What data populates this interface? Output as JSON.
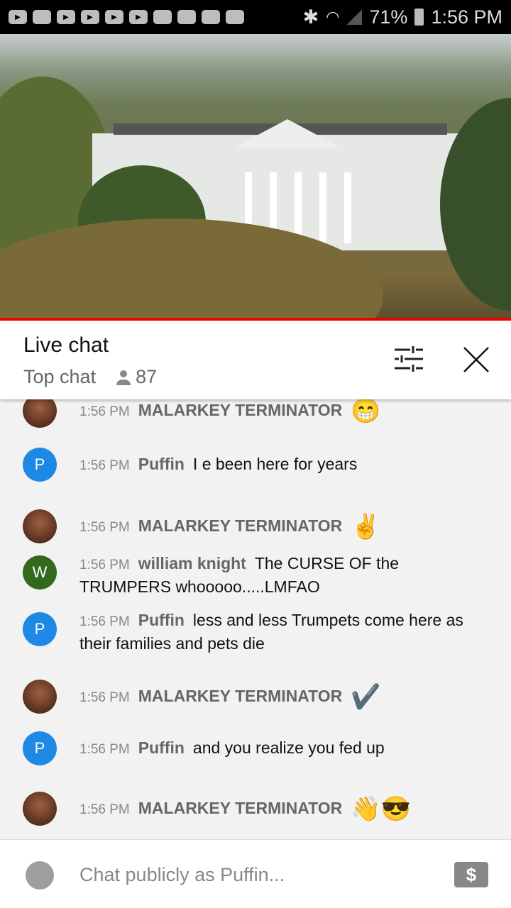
{
  "status_bar": {
    "battery": "71%",
    "time": "1:56 PM",
    "icons": [
      "youtube-icon",
      "crown-icon",
      "youtube-icon",
      "youtube-icon",
      "youtube-icon",
      "youtube-icon",
      "folder-icon",
      "warning-icon",
      "image-icon",
      "shopping-bag-icon",
      "bluetooth-icon",
      "wifi-icon",
      "signal-icon",
      "battery-icon"
    ]
  },
  "header": {
    "title": "Live chat",
    "mode": "Top chat",
    "viewer_count": "87"
  },
  "messages": [
    {
      "time": "1:56 PM",
      "author": "MALARKEY TERMINATOR",
      "text": "",
      "emoji": "😁",
      "avatar": "photo"
    },
    {
      "time": "1:56 PM",
      "author": "Puffin",
      "text": "I e been here for years",
      "emoji": "",
      "avatar": "P",
      "color": "#1e88e5"
    },
    {
      "time": "1:56 PM",
      "author": "MALARKEY TERMINATOR",
      "text": "",
      "emoji": "✌️",
      "avatar": "photo"
    },
    {
      "time": "1:56 PM",
      "author": "william knight",
      "text": "The CURSE OF the TRUMPERS whooooo.....LMFAO",
      "emoji": "",
      "avatar": "W",
      "color": "#33691e"
    },
    {
      "time": "1:56 PM",
      "author": "Puffin",
      "text": "less and less Trumpets come here as their families and pets die",
      "emoji": "",
      "avatar": "P",
      "color": "#1e88e5"
    },
    {
      "time": "1:56 PM",
      "author": "MALARKEY TERMINATOR",
      "text": "",
      "emoji": "✔️",
      "avatar": "photo"
    },
    {
      "time": "1:56 PM",
      "author": "Puffin",
      "text": "and you realize you fed up",
      "emoji": "",
      "avatar": "P",
      "color": "#1e88e5"
    },
    {
      "time": "1:56 PM",
      "author": "MALARKEY TERMINATOR",
      "text": "",
      "emoji": "👋😎",
      "avatar": "photo"
    }
  ],
  "input": {
    "placeholder": "Chat publicly as Puffin...",
    "money_icon": "$"
  },
  "colors": {
    "accent": "#e00000"
  }
}
